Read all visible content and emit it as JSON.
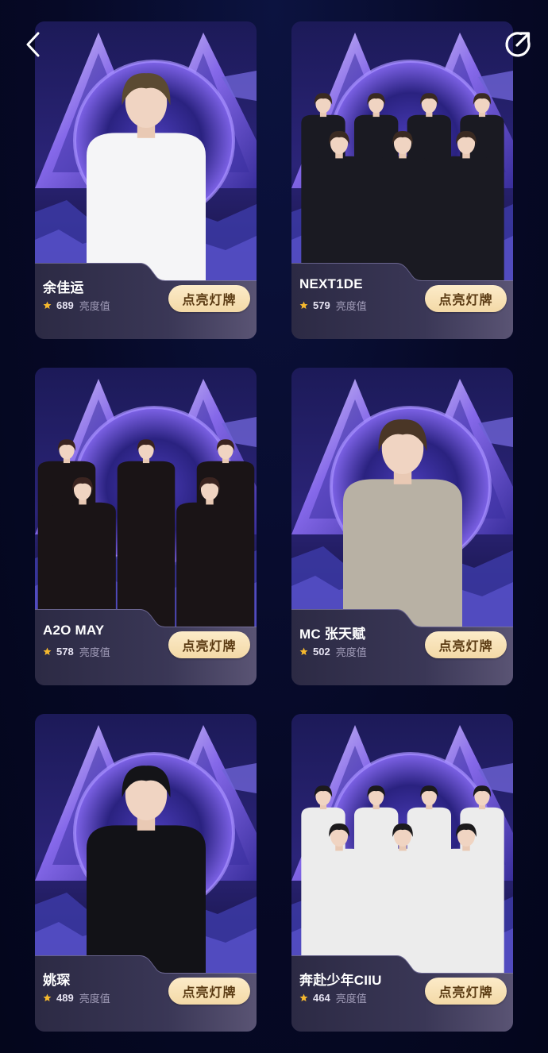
{
  "nav": {
    "back_icon": "chevron-left-icon",
    "share_icon": "share-icon"
  },
  "colors": {
    "page_background": "#050822",
    "button_background": "#f7e0b2",
    "button_text": "#5a3a12",
    "star": "#f5b82e",
    "crystal_primary": "#8a6cf0",
    "crystal_secondary": "#3a2f9e"
  },
  "score_unit_label": "亮度值",
  "button_label": "点亮灯牌",
  "artists": [
    {
      "name": "余佳运",
      "score": "689",
      "members": 1,
      "outfit": "#f5f5f7",
      "hair": "#5b4a32"
    },
    {
      "name": "NEXT1DE",
      "score": "579",
      "members": 7,
      "outfit": "#1a1a22",
      "hair": "#3a2a22"
    },
    {
      "name": "A2O MAY",
      "score": "578",
      "members": 5,
      "outfit": "#1a1416",
      "hair": "#3b2420"
    },
    {
      "name": "MC 张天赋",
      "score": "502",
      "members": 1,
      "outfit": "#b8b1a4",
      "hair": "#4a3626"
    },
    {
      "name": "姚琛",
      "score": "489",
      "members": 1,
      "outfit": "#121217",
      "hair": "#141418"
    },
    {
      "name": "奔赴少年CIIU",
      "score": "464",
      "members": 7,
      "outfit": "#ececec",
      "hair": "#1c1a1c"
    }
  ]
}
